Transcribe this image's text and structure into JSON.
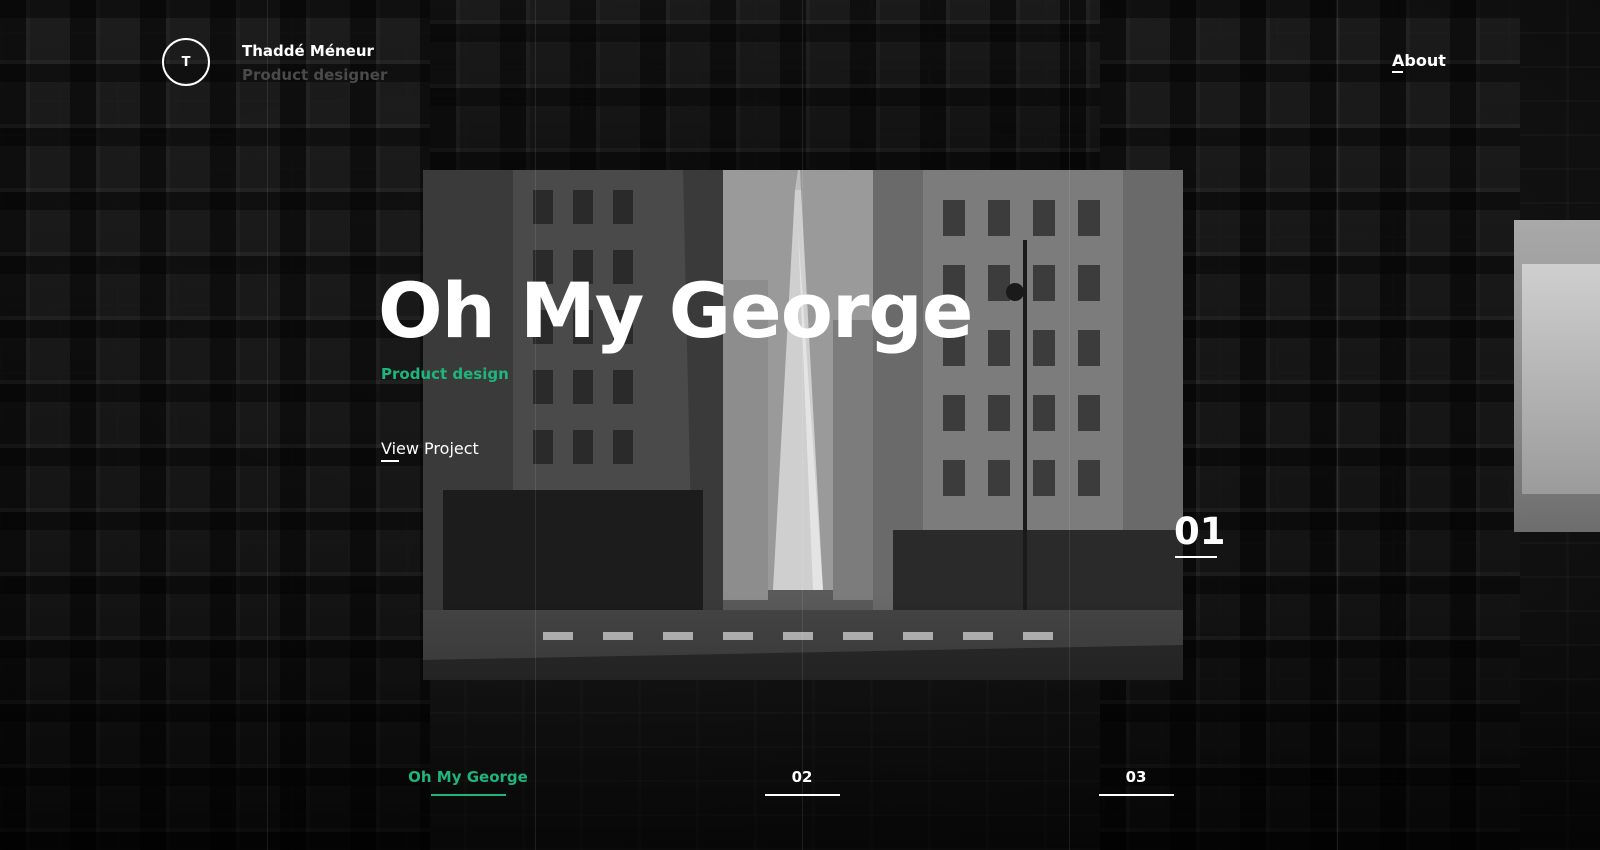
{
  "header": {
    "logo_letter": "T",
    "name": "Thaddé Méneur",
    "role": "Product designer",
    "about_label": "About"
  },
  "hero": {
    "title": "Oh My George",
    "category": "Product design",
    "cta_label": "View Project",
    "slide_number": "01"
  },
  "slider_nav": {
    "items": [
      {
        "label": "Oh My George",
        "active": true
      },
      {
        "label": "02",
        "active": false
      },
      {
        "label": "03",
        "active": false
      }
    ]
  },
  "colors": {
    "accent": "#1fb57c",
    "background": "#0c0c0c",
    "text": "#ffffff",
    "muted": "#4a4a4a"
  }
}
